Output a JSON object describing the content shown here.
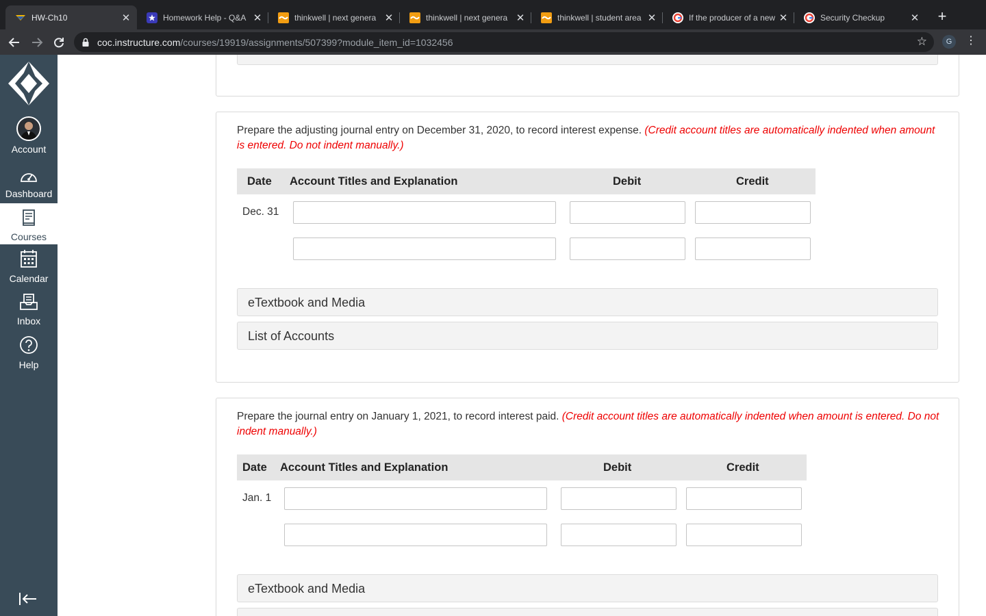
{
  "browser": {
    "tabs": [
      {
        "title": "HW-Ch10",
        "icon": "canvas-favicon-icon",
        "active": true
      },
      {
        "title": "Homework Help - Q&A",
        "icon": "star-favicon-icon",
        "active": false
      },
      {
        "title": "thinkwell | next genera",
        "icon": "thinkwell-favicon-icon",
        "active": false
      },
      {
        "title": "thinkwell | next genera",
        "icon": "thinkwell-favicon-icon",
        "active": false
      },
      {
        "title": "thinkwell | student area",
        "icon": "thinkwell-favicon-icon",
        "active": false
      },
      {
        "title": "If the producer of a new",
        "icon": "google-favicon-icon",
        "active": false
      },
      {
        "title": "Security Checkup",
        "icon": "google-favicon-icon",
        "active": false
      }
    ],
    "close_glyph": "✕",
    "new_tab_glyph": "+",
    "url_host": "coc.instructure.com",
    "url_path": "/courses/19919/assignments/507399?module_item_id=1032456",
    "profile_initial": "G"
  },
  "nav": {
    "items": [
      {
        "label": "Account",
        "icon": "avatar-icon",
        "active": false
      },
      {
        "label": "Dashboard",
        "icon": "dashboard-icon",
        "active": false
      },
      {
        "label": "Courses",
        "icon": "courses-icon",
        "active": true
      },
      {
        "label": "Calendar",
        "icon": "calendar-icon",
        "active": false
      },
      {
        "label": "Inbox",
        "icon": "inbox-icon",
        "active": false
      },
      {
        "label": "Help",
        "icon": "help-icon",
        "active": false
      }
    ]
  },
  "questions": [
    {
      "prompt": "Prepare the adjusting journal entry on December 31, 2020, to record interest expense.",
      "instruction": "(Credit account titles are automatically indented when amount is entered. Do not indent manually.)",
      "headers": {
        "date": "Date",
        "account": "Account Titles and Explanation",
        "debit": "Debit",
        "credit": "Credit"
      },
      "date": "Dec. 31",
      "rows": [
        {
          "account": "",
          "debit": "",
          "credit": ""
        },
        {
          "account": "",
          "debit": "",
          "credit": ""
        }
      ],
      "panels": [
        "eTextbook and Media",
        "List of Accounts"
      ]
    },
    {
      "prompt": "Prepare the journal entry on January 1, 2021, to record interest paid.",
      "instruction": "(Credit account titles are automatically indented when amount is entered. Do not indent manually.)",
      "headers": {
        "date": "Date",
        "account": "Account Titles and Explanation",
        "debit": "Debit",
        "credit": "Credit"
      },
      "date": "Jan. 1",
      "rows": [
        {
          "account": "",
          "debit": "",
          "credit": ""
        },
        {
          "account": "",
          "debit": "",
          "credit": ""
        }
      ],
      "panels": [
        "eTextbook and Media"
      ]
    }
  ],
  "colors": {
    "nav_bg": "#394b58",
    "instruction_red": "#e00000",
    "table_header_bg": "#e5e5e5"
  }
}
